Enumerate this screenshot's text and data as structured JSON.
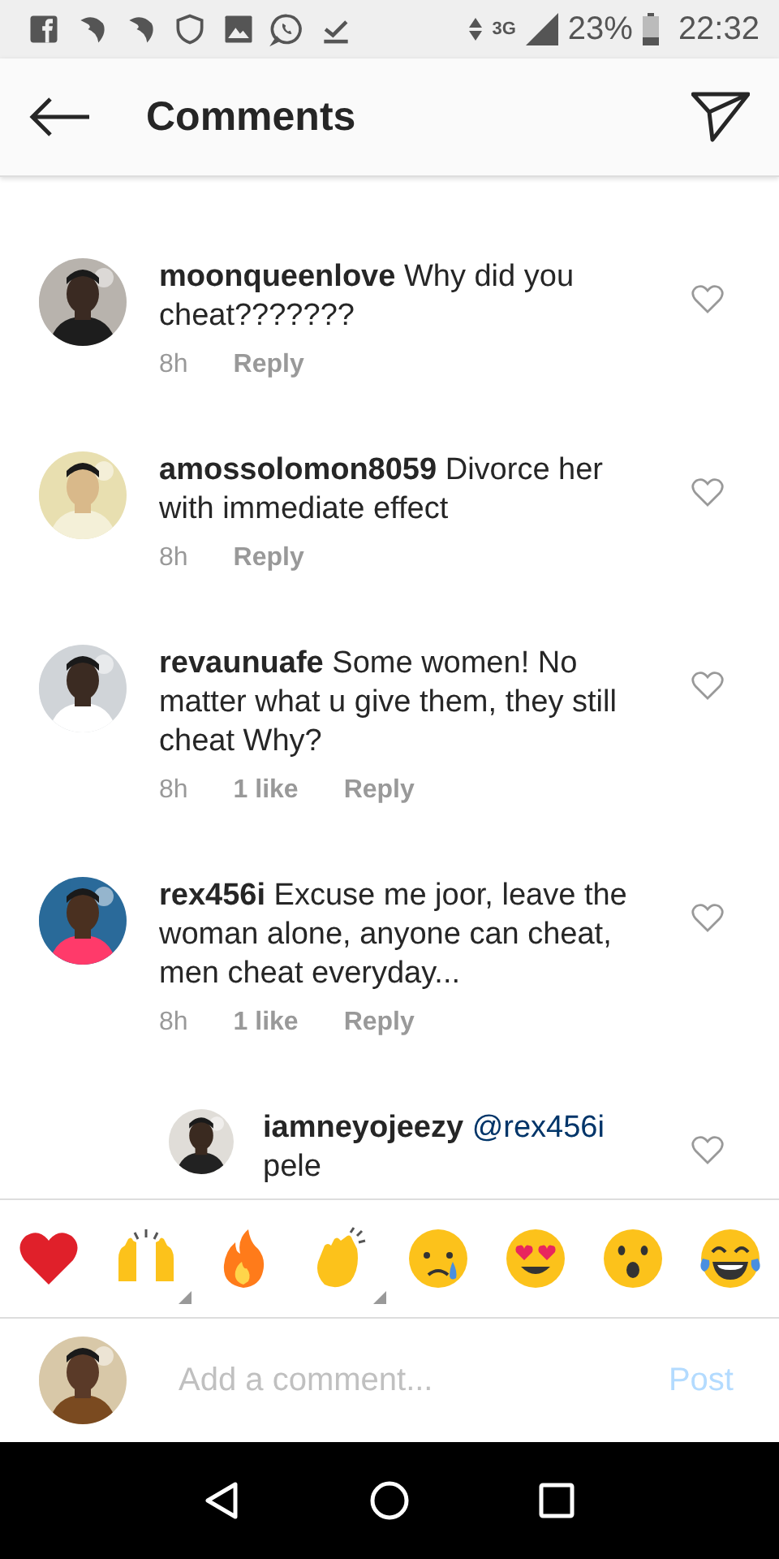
{
  "status_bar": {
    "network": "3G",
    "battery": "23%",
    "time": "22:32"
  },
  "header": {
    "title": "Comments"
  },
  "comments": [
    {
      "username": "moonqueenlove",
      "text": "Why did you cheat???????",
      "time": "8h",
      "reply": "Reply",
      "liked": false
    },
    {
      "username": "amossolomon8059",
      "text": "Divorce her with immediate effect",
      "time": "8h",
      "reply": "Reply",
      "liked": false
    },
    {
      "username": "revaunuafe",
      "text": "Some women! No matter what u give them, they still cheat Why?",
      "time": "8h",
      "likes": "1 like",
      "reply": "Reply",
      "liked": false
    },
    {
      "username": "rex456i",
      "text": "Excuse me joor,  leave the woman alone,  anyone can cheat, men cheat everyday...",
      "time": "8h",
      "likes": "1 like",
      "reply": "Reply",
      "liked": false
    },
    {
      "username": "iamneyojeezy",
      "mention": "@rex456i",
      "text": "pele",
      "kind": "reply",
      "liked": false
    }
  ],
  "emoji_bar": [
    {
      "kind": "heart",
      "variants": false
    },
    {
      "kind": "raised-hands",
      "variants": true
    },
    {
      "kind": "fire",
      "variants": false
    },
    {
      "kind": "clap",
      "variants": true
    },
    {
      "kind": "crying",
      "variants": false
    },
    {
      "kind": "heart-eyes",
      "variants": false
    },
    {
      "kind": "surprised",
      "variants": false
    },
    {
      "kind": "laughing",
      "variants": false
    }
  ],
  "composer": {
    "placeholder": "Add a comment...",
    "post": "Post"
  }
}
